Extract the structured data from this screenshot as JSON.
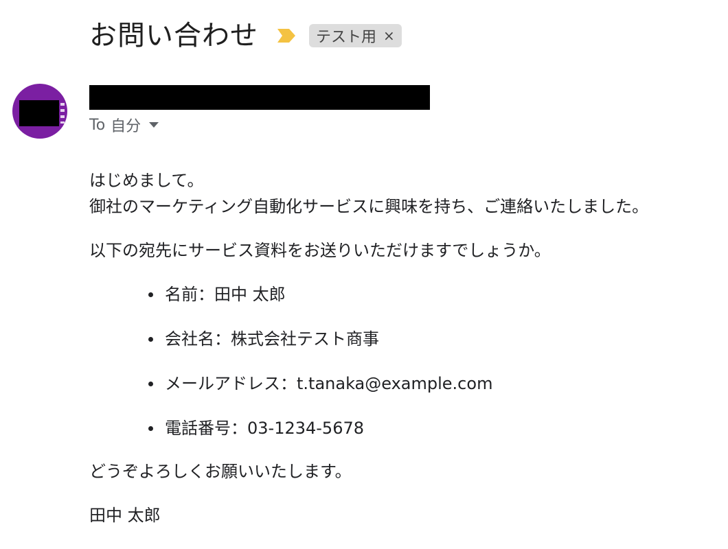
{
  "email": {
    "subject": "お問い合わせ",
    "label": "テスト用",
    "label_close": "×",
    "recipient_prefix": "To",
    "recipient": "自分",
    "body": {
      "greeting": "はじめまして。",
      "intro": "御社のマーケティング自動化サービスに興味を持ち、ご連絡いたしました。",
      "request": "以下の宛先にサービス資料をお送りいただけますでしょうか。",
      "details": [
        "名前：田中 太郎",
        "会社名：株式会社テスト商事",
        "メールアドレス：t.tanaka@example.com",
        "電話番号：03-1234-5678"
      ],
      "closing": "どうぞよろしくお願いいたします。",
      "signature": "田中 太郎"
    }
  },
  "colors": {
    "avatar": "#7b1fa2",
    "importance_marker": "#f4c242",
    "label_chip": "#dddddd"
  },
  "icons": {
    "importance": "importance-marker-icon",
    "dropdown": "chevron-down-icon",
    "close": "close-icon"
  }
}
